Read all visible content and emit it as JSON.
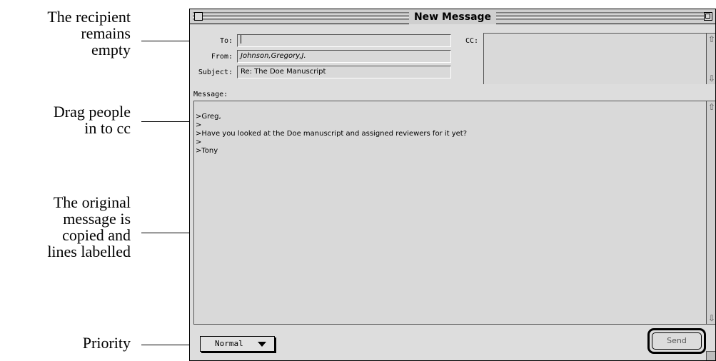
{
  "annotations": [
    {
      "lines": [
        "The recipient",
        "remains",
        "empty"
      ]
    },
    {
      "lines": [
        "Drag people",
        "in to cc"
      ]
    },
    {
      "lines": [
        "The original",
        "message is",
        "copied and",
        "lines labelled"
      ]
    },
    {
      "lines": [
        "Priority"
      ]
    }
  ],
  "window": {
    "title": "New Message",
    "to_label": "To:",
    "to_value": "",
    "cc_label": "CC:",
    "from_label": "From:",
    "from_value": "Johnson,Gregory,J.",
    "subject_label": "Subject:",
    "subject_value": "Re: The Doe Manuscript",
    "message_label": "Message:",
    "message_lines": [
      ">Greg,",
      ">",
      ">Have you looked at the Doe manuscript and assigned reviewers for it yet?",
      ">",
      ">Tony"
    ],
    "priority": "Normal",
    "send_label": "Send"
  }
}
